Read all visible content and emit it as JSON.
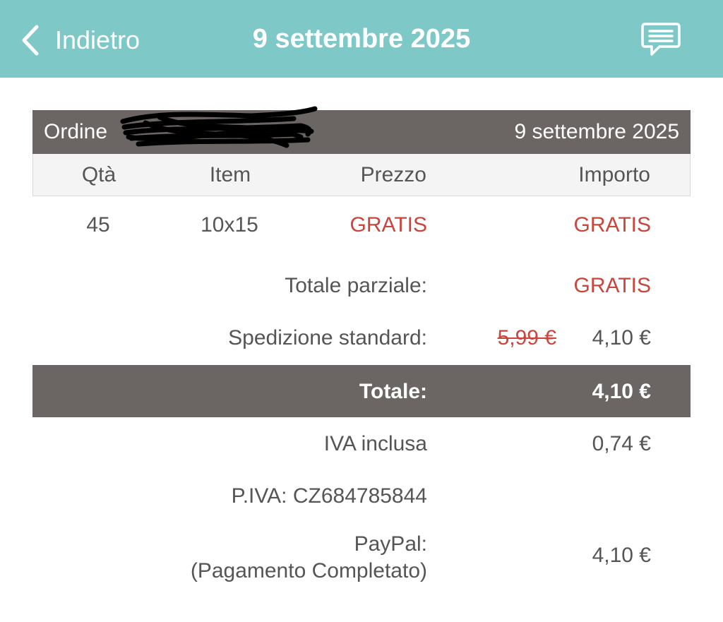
{
  "nav": {
    "back_label": "Indietro",
    "title": "9 settembre 2025",
    "chat_icon": "chat-bubble-icon"
  },
  "order": {
    "label": "Ordine ",
    "date": "9 settembre 2025"
  },
  "columns": {
    "qty": "Qtà",
    "item": "Item",
    "price": "Prezzo",
    "amount": "Importo"
  },
  "items": [
    {
      "qty": "45",
      "item": "10x15",
      "price": "GRATIS",
      "amount": "GRATIS"
    }
  ],
  "summary": {
    "subtotal_label": "Totale parziale:",
    "subtotal_value": "GRATIS",
    "shipping_label": "Spedizione standard:",
    "shipping_old": "5,99 €",
    "shipping_value": "4,10 €",
    "total_label": "Totale:",
    "total_value": "4,10 €",
    "vat_label": "IVA inclusa",
    "vat_value": "0,74 €",
    "vat_number": "P.IVA: CZ684785844",
    "payment_method": "PayPal:",
    "payment_status": "(Pagamento Completato)",
    "payment_value": "4,10 €"
  },
  "colors": {
    "header_bg": "#7ec8c8",
    "bar_bg": "#6b6564",
    "free_red": "#c9463d"
  }
}
